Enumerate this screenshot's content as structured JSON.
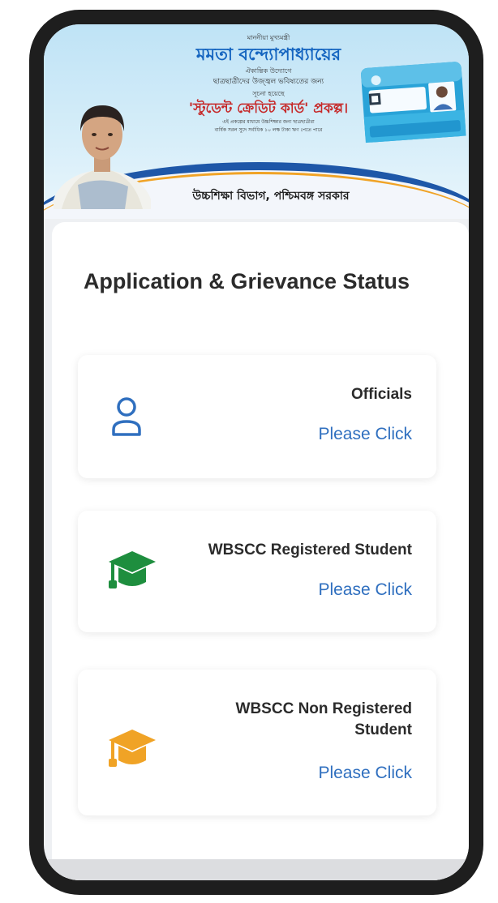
{
  "banner": {
    "line1": "মাননীয়া মুখ্যমন্ত্রী",
    "name": "মমতা বন্দ্যোপাধ্যায়ের",
    "line3": "ঐকান্তিক উদ্যোগে",
    "line4": "ছাত্রছাত্রীদের উজ্জ্বল ভবিষ্যতের জন্য",
    "line5": "সূচনা হয়েছে",
    "scheme": "'স্টুডেন্ট ক্রেডিট কার্ড' প্রকল্প।",
    "line7": "এই প্রকল্পের মাধ্যমে উচ্চশিক্ষার জন্য ছাত্রছাত্রীরা",
    "line8": "বার্ষিক সরল সুদে সর্বাধিক ১০ লক্ষ টাকা ঋণ পেতে পারে",
    "dept": "উচ্চশিক্ষা বিভাগ, পশ্চিমবঙ্গ সরকার"
  },
  "main": {
    "title": "Application & Grievance Status"
  },
  "options": [
    {
      "title": "Officials",
      "link": "Please Click",
      "icon": "person-icon",
      "color": "#2f6fbf"
    },
    {
      "title": "WBSCC Registered Student",
      "link": "Please Click",
      "icon": "graduation-cap-icon",
      "color": "#1e8e3e"
    },
    {
      "title": "WBSCC Non Registered Student",
      "link": "Please Click",
      "icon": "graduation-cap-icon",
      "color": "#f0a326"
    }
  ],
  "colors": {
    "accent": "#2f6fbf",
    "banner_blue": "#1565c0",
    "scheme_red": "#c62828"
  }
}
